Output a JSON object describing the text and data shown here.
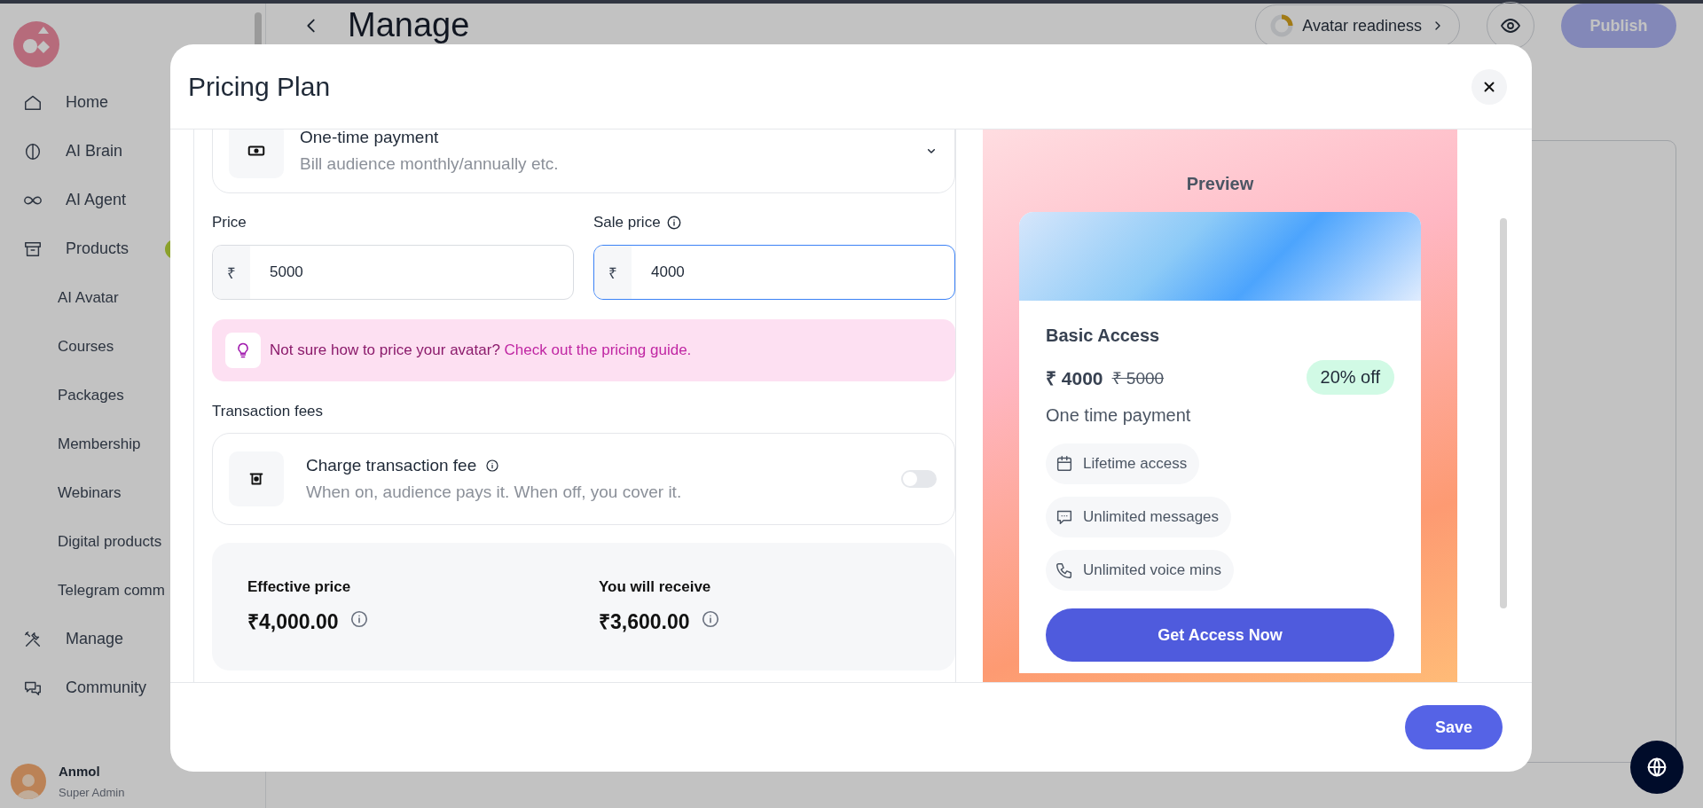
{
  "sidebar": {
    "items": [
      {
        "label": "Home"
      },
      {
        "label": "AI Brain"
      },
      {
        "label": "AI Agent"
      },
      {
        "label": "Products",
        "expanded": true,
        "children": [
          {
            "label": "AI Avatar"
          },
          {
            "label": "Courses"
          },
          {
            "label": "Packages"
          },
          {
            "label": "Membership"
          },
          {
            "label": "Webinars"
          },
          {
            "label": "Digital products"
          },
          {
            "label": "Telegram comm"
          }
        ]
      },
      {
        "label": "Manage"
      },
      {
        "label": "Community"
      }
    ],
    "user": {
      "name": "Anmol",
      "role": "Super Admin"
    }
  },
  "header": {
    "title": "Manage",
    "readiness": "Avatar readiness",
    "publish": {
      "label": "Publish",
      "disabled": true
    }
  },
  "modal": {
    "title": "Pricing Plan",
    "payment_type": {
      "title": "One-time payment",
      "description": "Bill audience monthly/annually etc."
    },
    "price": {
      "label": "Price",
      "currency": "₹",
      "value": "5000",
      "focused": false
    },
    "sale_price": {
      "label": "Sale price",
      "currency": "₹",
      "value": "4000",
      "focused": true
    },
    "tip": {
      "text": "Not sure how to price your avatar?",
      "link": "Check out the pricing guide."
    },
    "fees_heading": "Transaction fees",
    "fee": {
      "title": "Charge transaction fee",
      "description": "When on, audience pays it. When off, you cover it.",
      "on": false
    },
    "summary": [
      {
        "label": "Effective price",
        "value": "₹4,000.00"
      },
      {
        "label": "You will receive",
        "value": "₹3,600.00"
      }
    ],
    "preview": {
      "heading": "Preview",
      "plan": "Basic Access",
      "price": "₹ 4000",
      "original_price": "₹ 5000",
      "discount": "20% off",
      "billing": "One time payment",
      "features": [
        {
          "label": "Lifetime access"
        },
        {
          "label": "Unlimited messages"
        },
        {
          "label": "Unlimited voice mins"
        }
      ],
      "cta": "Get Access Now"
    },
    "save": "Save"
  }
}
